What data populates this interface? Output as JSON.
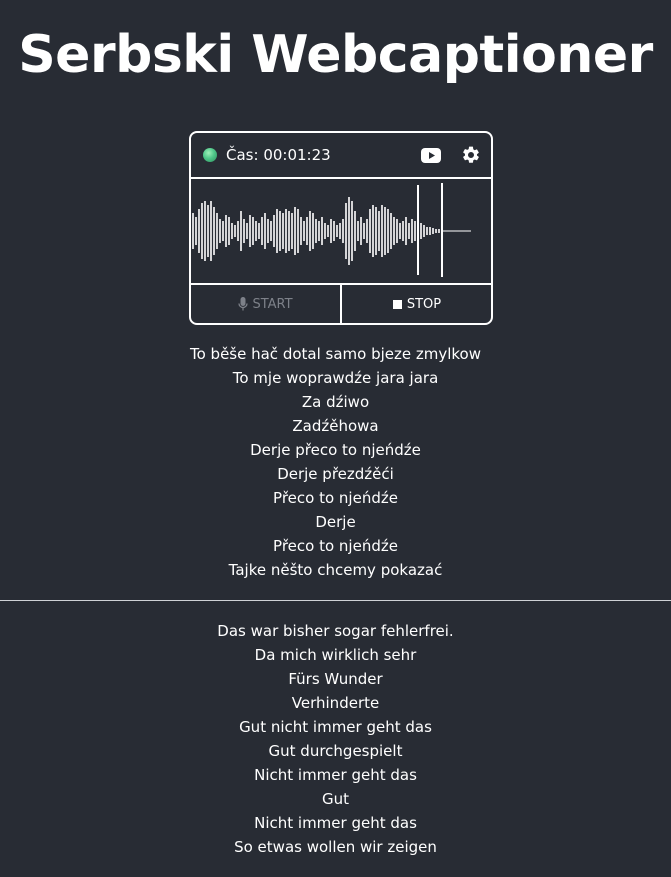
{
  "app": {
    "title": "Serbski Webcaptioner"
  },
  "recorder": {
    "time_label": "Čas:",
    "time_value": "00:01:23",
    "status": "recording",
    "status_color": "#4fc78a",
    "youtube_icon": "youtube-icon",
    "settings_icon": "gear-icon",
    "start_label": "START",
    "start_icon": "microphone-icon",
    "stop_label": "STOP",
    "stop_icon": "stop-square-icon",
    "start_enabled": false
  },
  "captions": {
    "source_lines": [
      "To běše hač dotal samo bjeze zmylkow",
      "To mje woprawdźe jara jara",
      "Za dźiwo",
      "Zadźěhowa",
      "Derje přeco to njeńdźe",
      "Derje přezdźěći",
      "Přeco to njeńdźe",
      "Derje",
      "Přeco to njeńdźe",
      "Tajke něšto chcemy pokazać"
    ],
    "translation_lines": [
      "Das war bisher sogar fehlerfrei.",
      "Da mich wirklich sehr",
      "Fürs Wunder",
      "Verhinderte",
      "Gut nicht immer geht das",
      "Gut durchgespielt",
      "Nicht immer geht das",
      "Gut",
      "Nicht immer geht das",
      "So etwas wollen wir zeigen"
    ]
  }
}
